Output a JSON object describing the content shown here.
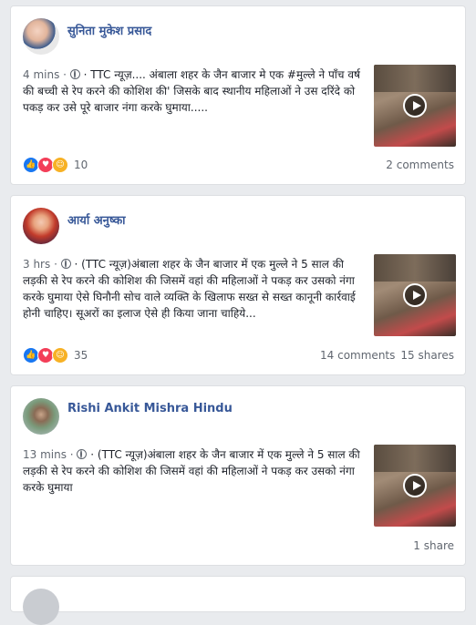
{
  "posts": [
    {
      "author": "सुनिता मुकेश प्रसाद",
      "time": "4 mins",
      "text": "· TTC न्यूज़.... अंबाला शहर के जैन बाजार मे एक #मुल्ले ने पाँच वर्ष की बच्ची से रेप करने की कोशिश की' जिसके बाद स्थानीय महिलाओं ने उस दरिंदे को पकड़ कर उसे पूरे बाजार नंगा करके घुमाया.....",
      "reaction_count": "10",
      "comments": "2 comments",
      "shares": ""
    },
    {
      "author": "आर्या अनुष्का",
      "time": "3 hrs",
      "text": "· (TTC न्यूज़)अंबाला शहर के जैन बाजार में एक मुल्ले ने 5 साल की लड़की से रेप करने की कोशिश की जिसमें वहां की महिलाओं ने पकड़ कर उसको नंगा करके घुमाया ऐसे घिनौनी सोच वाले व्यक्ति के खिलाफ सख्त से सख्त कानूनी कार्रवाई होनी चाहिए। सूअरों का इलाज ऐसे ही किया जाना चाहिये...",
      "reaction_count": "35",
      "comments": "14 comments",
      "shares": "15 shares"
    },
    {
      "author": "Rishi Ankit Mishra Hindu",
      "time": "13 mins",
      "text": "· (TTC न्यूज़)अंबाला शहर के जैन बाजार में एक मुल्ले ने 5 साल की लड़की से रेप करने की कोशिश की जिसमें वहां की महिलाओं ने पकड़ कर उसको नंगा करके घुमाया",
      "reaction_count": "",
      "comments": "",
      "shares": "1 share"
    }
  ],
  "icons": {
    "privacy": "globe-icon",
    "video_play": "play-icon",
    "reactions": [
      "like-icon",
      "love-icon",
      "haha-icon"
    ]
  },
  "colors": {
    "author_link": "#385898",
    "like": "#1877f2",
    "love": "#f33e58",
    "haha": "#f7b125",
    "background": "#e9ebee"
  }
}
